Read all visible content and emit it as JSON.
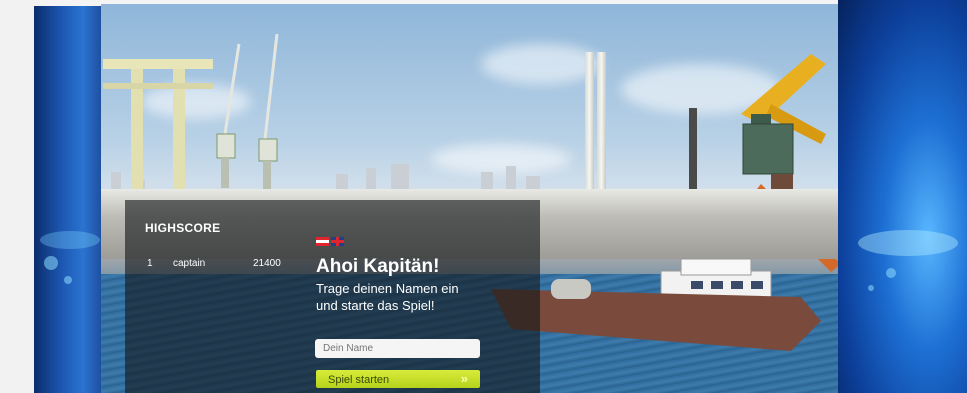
{
  "highscore": {
    "title": "HIGHSCORE",
    "entries": [
      {
        "rank": "1",
        "name": "captain",
        "score": "21400"
      }
    ]
  },
  "language": {
    "flags": [
      "austria-flag-icon",
      "uk-flag-icon"
    ]
  },
  "welcome": {
    "heading": "Ahoi Kapitän!",
    "line1": "Trage deinen Namen ein",
    "line2": "und starte das Spiel!"
  },
  "form": {
    "name_placeholder": "Dein Name",
    "start_label": "Spiel starten"
  },
  "colors": {
    "accent": "#c7e02a",
    "frame": "#1d57b3"
  }
}
